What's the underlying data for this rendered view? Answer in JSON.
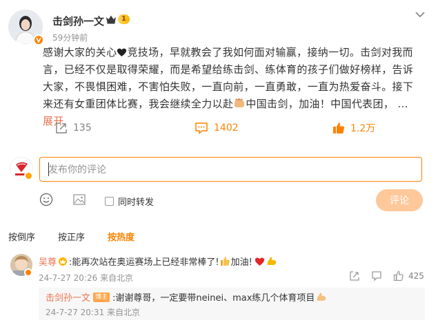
{
  "post": {
    "author": "击剑孙一文",
    "level": "1",
    "time": "59分钟前",
    "text_parts": [
      "感谢大家的关心",
      "竞技场，早就教会了我如何面对输赢，接纳一切。击剑对我而言，已经不仅是取得荣耀，而是希望给练击剑、练体育的孩子们做好榜样，告诉大家，不畏惧困难，不害怕失败，一直向前，一直勇敢，一直为热爱奋斗。接下来还有女重团体比赛，我会继续全力以赴",
      "中国击剑，加油！中国代表团，  ... "
    ],
    "expand_label": "展开",
    "icons": [
      "heart-icon",
      "fist-icon"
    ]
  },
  "actions": {
    "repost_count": "135",
    "comment_count": "1402",
    "like_count": "1.2万"
  },
  "comment_box": {
    "placeholder": "发布你的评论",
    "forward_label": "同时转发",
    "submit_label": "评论"
  },
  "sort": {
    "options": [
      "按倒序",
      "按正序",
      "按热度"
    ],
    "active": "按热度"
  },
  "comments": [
    {
      "author": "吴尊",
      "text": ":能再次站在奥运赛场上已经非常棒了!",
      "text2": "加油!",
      "meta": "24-7-27 20:26 来自北京",
      "like_count": "425",
      "reply": {
        "author": "击剑孙一文",
        "tag": "博主",
        "text": ":谢谢尊哥，一定要带neinei、max练几个体育项目",
        "meta": "24-7-27 20:31 来自北京"
      }
    }
  ],
  "colors": {
    "accent": "#ff8200",
    "link": "#eb7350",
    "muted": "#939393"
  }
}
